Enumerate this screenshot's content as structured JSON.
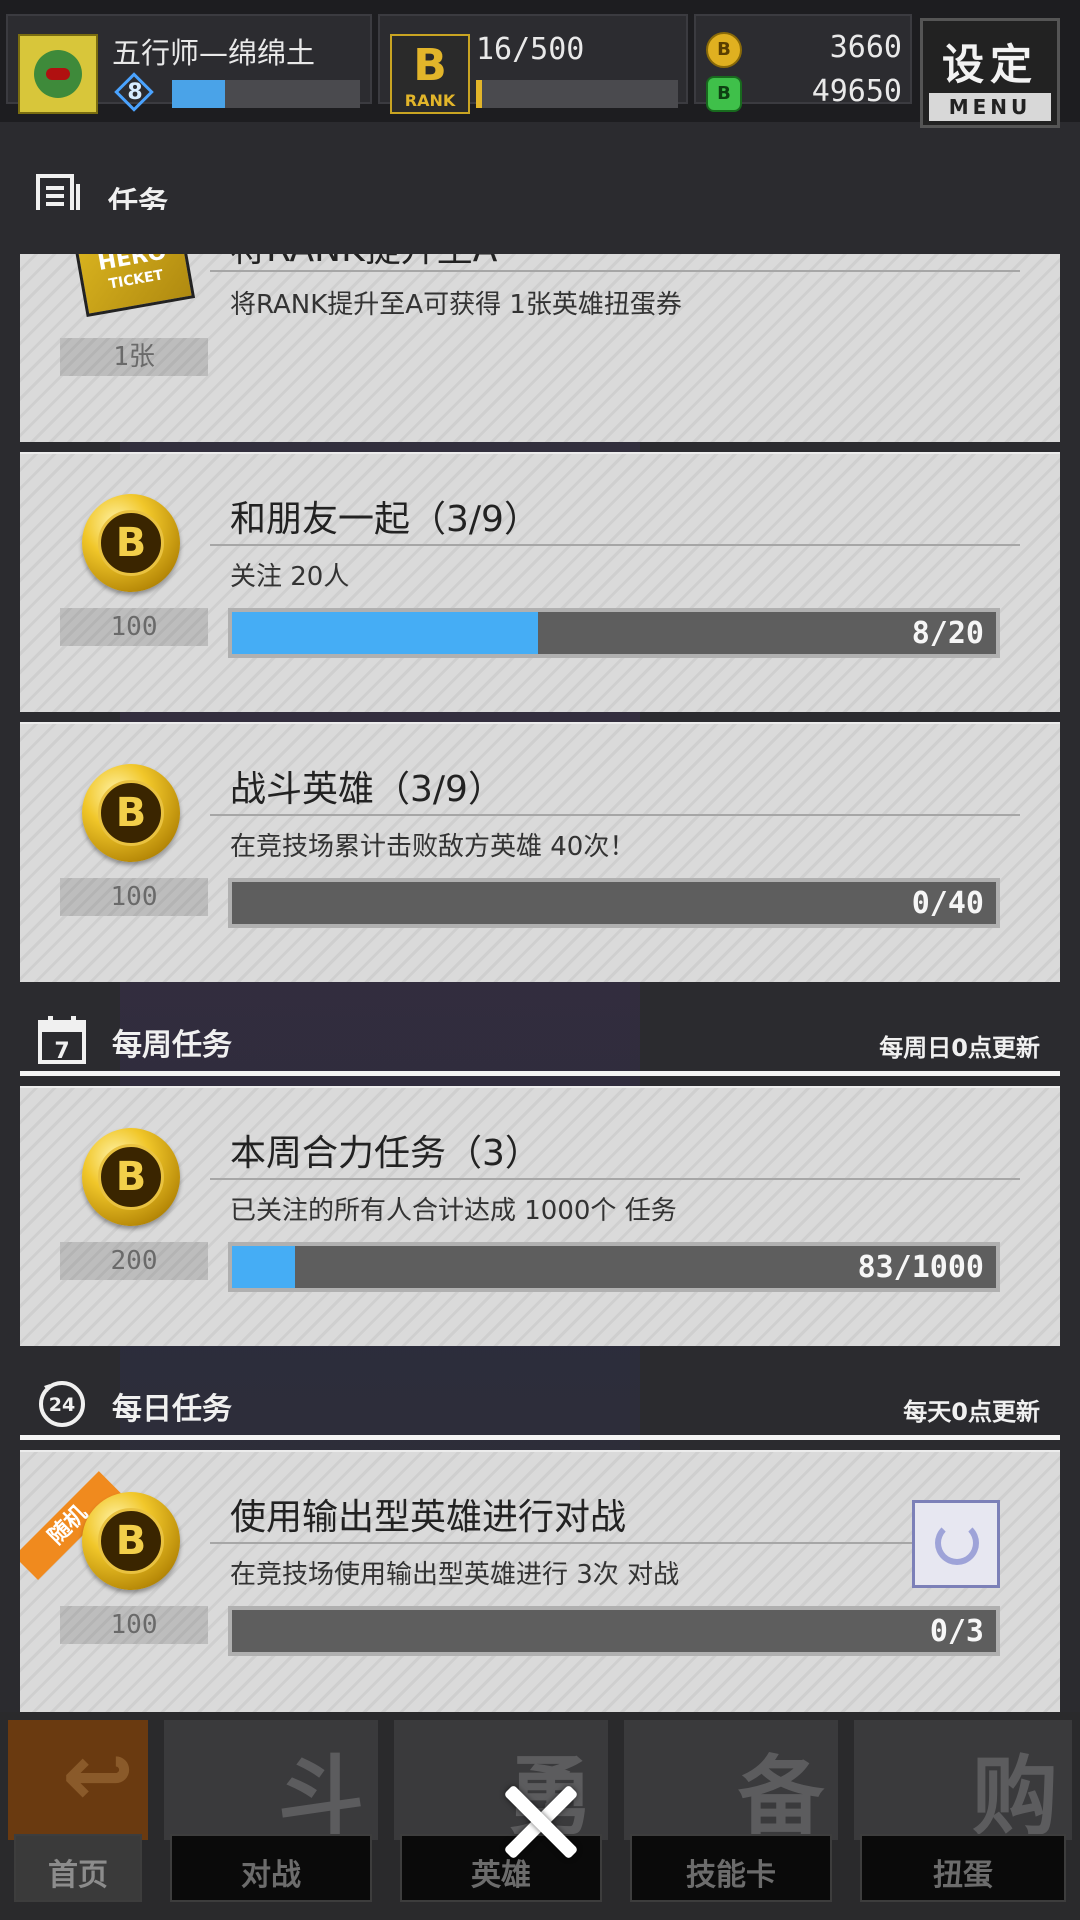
{
  "hud": {
    "player_name": "五行师—绵绵土",
    "level": "8",
    "exp_fraction": 0.28,
    "rank_letter": "B",
    "rank_word": "RANK",
    "rank_progress": "16/500",
    "rank_fraction": 0.03,
    "gold_coin_icon": "gold-coin-icon",
    "gold_coin_letter": "B",
    "gold_count": "3660",
    "green_coin_icon": "green-coin-icon",
    "green_coin_letter": "B",
    "green_count": "49650",
    "menu_label": "设定",
    "menu_sub": "MENU"
  },
  "missions_header": {
    "title": "任务",
    "icon": "document-list-icon"
  },
  "tasks": [
    {
      "title": "将RANK提升至A",
      "desc": "将RANK提升至A可获得 1张英雄扭蛋券",
      "reward": "1张",
      "reward_icon": "hero-ticket-icon",
      "ticket_word": "HERO",
      "ticket_sub": "TICKET"
    },
    {
      "title": "和朋友一起（3/9）",
      "desc": "关注 20人",
      "reward": "100",
      "reward_icon": "gold-coin-icon",
      "coin_letter": "B",
      "progress_text": "8/20",
      "progress_fraction": 0.4
    },
    {
      "title": "战斗英雄（3/9）",
      "desc": "在竞技场累计击败敌方英雄 40次！",
      "reward": "100",
      "reward_icon": "gold-coin-icon",
      "coin_letter": "B",
      "progress_text": "0/40",
      "progress_fraction": 0
    }
  ],
  "weekly": {
    "title": "每周任务",
    "note": "每周日0点更新",
    "icon": "calendar-7-icon",
    "icon_text": "7",
    "task": {
      "title": "本周合力任务（3）",
      "desc": "已关注的所有人合计达成 1000个 任务",
      "reward": "200",
      "reward_icon": "gold-coin-icon",
      "coin_letter": "B",
      "progress_text": "83/1000",
      "progress_fraction": 0.083
    }
  },
  "daily": {
    "title": "每日任务",
    "note": "每天0点更新",
    "icon": "clock-24-icon",
    "icon_text": "24",
    "task": {
      "tag": "随机",
      "title": "使用输出型英雄进行对战",
      "desc": "在竞技场使用输出型英雄进行 3次 对战",
      "reward": "100",
      "reward_icon": "gold-coin-icon",
      "coin_letter": "B",
      "progress_text": "0/3",
      "progress_fraction": 0,
      "refresh_icon": "refresh-icon"
    }
  },
  "nav": [
    {
      "label": "首页",
      "icon": "return-arrow-icon",
      "glyph": "↩"
    },
    {
      "label": "对战",
      "icon": "gamepad-icon",
      "glyph": "斗"
    },
    {
      "label": "英雄",
      "icon": "hero-icon",
      "glyph": "勇"
    },
    {
      "label": "技能卡",
      "icon": "cards-icon",
      "glyph": "备"
    },
    {
      "label": "扭蛋",
      "icon": "gacha-icon",
      "glyph": "购"
    }
  ],
  "close_icon": "close-icon",
  "colors": {
    "accent_blue": "#45adf5",
    "gold": "#e2b52a",
    "random_tag": "#f08a1e"
  }
}
